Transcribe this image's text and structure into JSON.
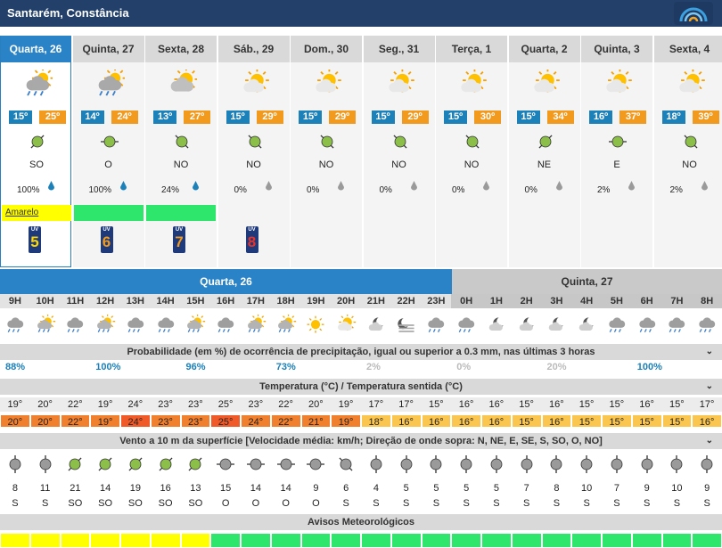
{
  "location": "Santarém, Constância",
  "colors": {
    "header": "#23406a",
    "selected": "#2a83c6",
    "tmin": "#1c80b9",
    "tmax": "#f29a1e",
    "yellow": "#ffff00",
    "green": "#2ee66b"
  },
  "days": [
    {
      "name": "Quarta, 26",
      "icon": "rain-cloud-sun-icon",
      "tmin": "15º",
      "tmax": "25º",
      "wind_dir": "SO",
      "prob": "100%",
      "drop": "blue",
      "warning": "Amarelo",
      "warning_color": "#ffff00",
      "uv": "5",
      "uv_color": "#ffd700"
    },
    {
      "name": "Quinta, 27",
      "icon": "rain-cloud-sun-icon",
      "tmin": "14º",
      "tmax": "24º",
      "wind_dir": "O",
      "prob": "100%",
      "drop": "blue",
      "warning": "",
      "warning_color": "#2ee66b",
      "uv": "6",
      "uv_color": "#f29a1e"
    },
    {
      "name": "Sexta, 28",
      "icon": "cloudy-sun-icon",
      "tmin": "13º",
      "tmax": "27º",
      "wind_dir": "NO",
      "prob": "24%",
      "drop": "blue",
      "warning": "",
      "warning_color": "#2ee66b",
      "uv": "7",
      "uv_color": "#f29a1e"
    },
    {
      "name": "Sáb., 29",
      "icon": "sun-cloud-icon",
      "tmin": "15º",
      "tmax": "29º",
      "wind_dir": "NO",
      "prob": "0%",
      "drop": "gray",
      "warning": "",
      "warning_color": "",
      "uv": "8",
      "uv_color": "#e8322a"
    },
    {
      "name": "Dom., 30",
      "icon": "sun-cloud-icon",
      "tmin": "15º",
      "tmax": "29º",
      "wind_dir": "NO",
      "prob": "0%",
      "drop": "gray",
      "warning": "",
      "warning_color": "",
      "uv": "",
      "uv_color": ""
    },
    {
      "name": "Seg., 31",
      "icon": "sun-cloud-icon",
      "tmin": "15º",
      "tmax": "29º",
      "wind_dir": "NO",
      "prob": "0%",
      "drop": "gray",
      "warning": "",
      "warning_color": "",
      "uv": "",
      "uv_color": ""
    },
    {
      "name": "Terça, 1",
      "icon": "sun-cloud-icon",
      "tmin": "15º",
      "tmax": "30º",
      "wind_dir": "NO",
      "prob": "0%",
      "drop": "gray",
      "warning": "",
      "warning_color": "",
      "uv": "",
      "uv_color": ""
    },
    {
      "name": "Quarta, 2",
      "icon": "sun-cloud-icon",
      "tmin": "15º",
      "tmax": "34º",
      "wind_dir": "NE",
      "prob": "0%",
      "drop": "gray",
      "warning": "",
      "warning_color": "",
      "uv": "",
      "uv_color": ""
    },
    {
      "name": "Quinta, 3",
      "icon": "sun-cloud-icon",
      "tmin": "16º",
      "tmax": "37º",
      "wind_dir": "E",
      "prob": "2%",
      "drop": "gray",
      "warning": "",
      "warning_color": "",
      "uv": "",
      "uv_color": ""
    },
    {
      "name": "Sexta, 4",
      "icon": "sun-cloud-icon",
      "tmin": "18º",
      "tmax": "39º",
      "wind_dir": "NO",
      "prob": "2%",
      "drop": "gray",
      "warning": "",
      "warning_color": "",
      "uv": "",
      "uv_color": ""
    }
  ],
  "hourly_header": {
    "day1": "Quarta, 26",
    "day2": "Quinta, 27"
  },
  "hours": [
    "9H",
    "10H",
    "11H",
    "12H",
    "13H",
    "14H",
    "15H",
    "16H",
    "17H",
    "18H",
    "19H",
    "20H",
    "21H",
    "22H",
    "23H",
    "0H",
    "1H",
    "2H",
    "3H",
    "4H",
    "5H",
    "6H",
    "7H",
    "8H"
  ],
  "hour_icons": [
    "rain-cloud-icon",
    "rain-sun-icon",
    "rain-cloud-icon",
    "rain-sun-icon",
    "rain-cloud-icon",
    "rain-cloud-icon",
    "rain-sun-icon",
    "rain-cloud-icon",
    "rain-sun-icon",
    "rain-sun-icon",
    "sun-icon",
    "sun-cloud-icon",
    "moon-cloud-icon",
    "fog-moon-icon",
    "rain-cloud-icon",
    "rain-cloud-icon",
    "moon-cloud-icon",
    "moon-cloud-icon",
    "moon-cloud-icon",
    "moon-cloud-icon",
    "rain-cloud-icon",
    "rain-cloud-icon",
    "rain-cloud-icon",
    "rain-cloud-icon"
  ],
  "precip_title": "Probabilidade (em %) de ocorrência de precipitação, igual ou superior a 0.3 mm, nas últimas 3 horas",
  "precip_values": [
    {
      "text": "88%",
      "col": 0,
      "color": "#1c80b9"
    },
    {
      "text": "100%",
      "col": 3,
      "color": "#1c80b9"
    },
    {
      "text": "96%",
      "col": 6,
      "color": "#1c80b9"
    },
    {
      "text": "73%",
      "col": 9,
      "color": "#1c80b9"
    },
    {
      "text": "2%",
      "col": 12,
      "color": "#bbbbbb"
    },
    {
      "text": "0%",
      "col": 15,
      "color": "#bbbbbb"
    },
    {
      "text": "20%",
      "col": 18,
      "color": "#bbbbbb"
    },
    {
      "text": "100%",
      "col": 21,
      "color": "#1c80b9"
    }
  ],
  "temp_title": "Temperatura (°C) / Temperatura sentida (°C)",
  "temps": [
    "19°",
    "20°",
    "22°",
    "19°",
    "24°",
    "23°",
    "23°",
    "25°",
    "23°",
    "22°",
    "20°",
    "19°",
    "17°",
    "17°",
    "15°",
    "16°",
    "16°",
    "15°",
    "16°",
    "15°",
    "15°",
    "16°",
    "15°",
    "17°"
  ],
  "feels": [
    "20°",
    "20°",
    "22°",
    "19°",
    "24°",
    "23°",
    "23°",
    "25°",
    "24°",
    "22°",
    "21°",
    "19°",
    "18°",
    "16°",
    "16°",
    "16°",
    "16°",
    "15°",
    "16°",
    "15°",
    "15°",
    "15°",
    "15°",
    "16°"
  ],
  "feels_colors": [
    "#f07f2e",
    "#f07f2e",
    "#f07f2e",
    "#f07f2e",
    "#f05a28",
    "#f07f2e",
    "#f07f2e",
    "#f05a28",
    "#f07f2e",
    "#f07f2e",
    "#f07f2e",
    "#f07f2e",
    "#fbc64f",
    "#fbc64f",
    "#fbc64f",
    "#fbc64f",
    "#fbc64f",
    "#fbc64f",
    "#fbc64f",
    "#fbc64f",
    "#fbc64f",
    "#fbc64f",
    "#fbc64f",
    "#fbc64f"
  ],
  "wind_title": "Vento a 10 m da superfície [Velocidade média: km/h; Direção de onde sopra: N, NE, E, SE, S, SO, O, NO]",
  "wind_speeds": [
    "8",
    "11",
    "21",
    "14",
    "19",
    "16",
    "13",
    "15",
    "14",
    "14",
    "9",
    "6",
    "4",
    "5",
    "5",
    "5",
    "5",
    "7",
    "8",
    "10",
    "7",
    "9",
    "10",
    "9"
  ],
  "wind_dirs": [
    "S",
    "S",
    "SO",
    "SO",
    "SO",
    "SO",
    "SO",
    "O",
    "O",
    "O",
    "O",
    "S",
    "S",
    "S",
    "S",
    "S",
    "S",
    "S",
    "S",
    "S",
    "S",
    "S",
    "S",
    "S"
  ],
  "wind_angles": [
    0,
    0,
    225,
    225,
    225,
    225,
    225,
    270,
    270,
    270,
    270,
    315,
    0,
    0,
    0,
    0,
    0,
    0,
    0,
    0,
    0,
    0,
    0,
    0
  ],
  "wind_fill": [
    "gray",
    "gray",
    "green",
    "green",
    "green",
    "green",
    "green",
    "gray",
    "gray",
    "gray",
    "gray",
    "gray",
    "gray",
    "gray",
    "gray",
    "gray",
    "gray",
    "gray",
    "gray",
    "gray",
    "gray",
    "gray",
    "gray",
    "gray"
  ],
  "warn_title": "Avisos Meteorológicos",
  "warn_colors": [
    "#ffff00",
    "#ffff00",
    "#ffff00",
    "#ffff00",
    "#ffff00",
    "#ffff00",
    "#ffff00",
    "#2ee66b",
    "#2ee66b",
    "#2ee66b",
    "#2ee66b",
    "#2ee66b",
    "#2ee66b",
    "#2ee66b",
    "#2ee66b",
    "#2ee66b",
    "#2ee66b",
    "#2ee66b",
    "#2ee66b",
    "#2ee66b",
    "#2ee66b",
    "#2ee66b",
    "#2ee66b",
    "#2ee66b"
  ]
}
